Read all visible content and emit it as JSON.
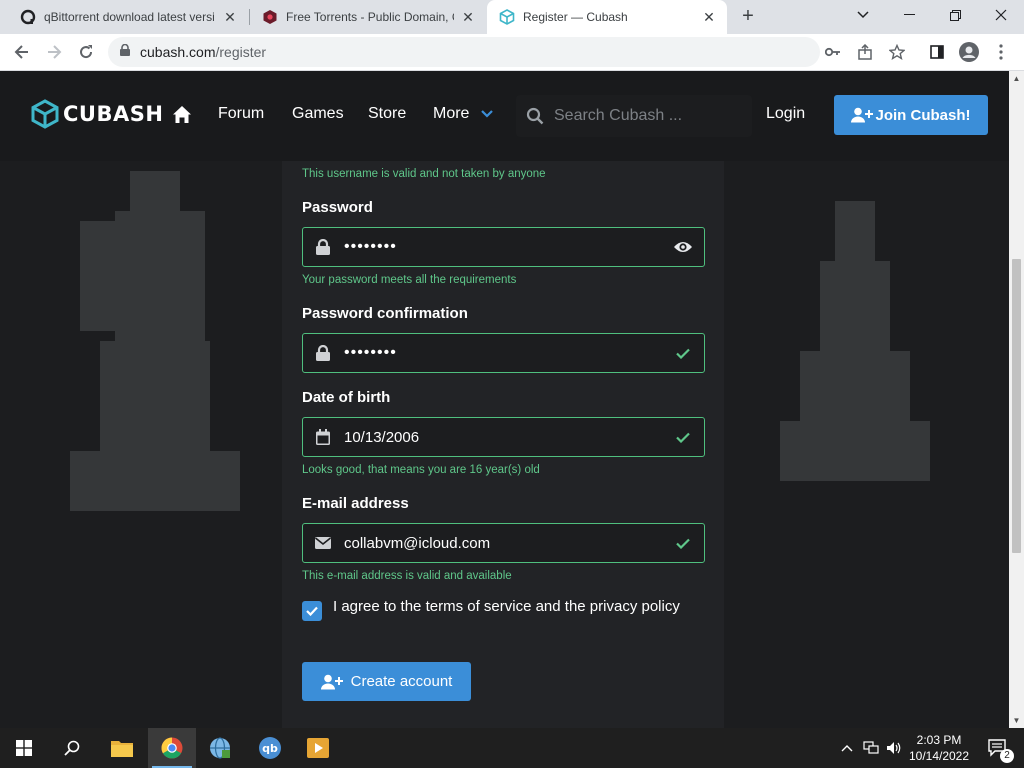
{
  "browser": {
    "tabs": [
      {
        "title": "qBittorrent download latest versi",
        "icon": "qbittorrent-favicon"
      },
      {
        "title": "Free Torrents - Public Domain, Cr",
        "icon": "torrent-site-favicon"
      },
      {
        "title": "Register — Cubash",
        "icon": "cubash-favicon",
        "active": true
      }
    ],
    "address": {
      "host": "cubash.com",
      "path": "/register"
    }
  },
  "site": {
    "logo_text": "CUBASH",
    "nav": {
      "forum": "Forum",
      "games": "Games",
      "store": "Store",
      "more": "More"
    },
    "search_placeholder": "Search Cubash ...",
    "login": "Login",
    "join": "Join Cubash!",
    "accent_color": "#3b8ed8",
    "valid_color": "#5fc78a"
  },
  "form": {
    "username_hint": "This username is valid and not taken by anyone",
    "password": {
      "label": "Password",
      "value": "••••••••",
      "hint": "Your password meets all the requirements"
    },
    "password_confirm": {
      "label": "Password confirmation",
      "value": "••••••••"
    },
    "dob": {
      "label": "Date of birth",
      "value": "10/13/2006",
      "hint": "Looks good, that means you are 16 year(s) old"
    },
    "email": {
      "label": "E-mail address",
      "value": "collabvm@icloud.com",
      "hint": "This e-mail address is valid and available"
    },
    "agree": {
      "text": "I agree to the terms of service and the privacy policy",
      "checked": true
    },
    "submit": "Create account"
  },
  "taskbar": {
    "time": "2:03 PM",
    "date": "10/14/2022",
    "notification_count": "2"
  }
}
